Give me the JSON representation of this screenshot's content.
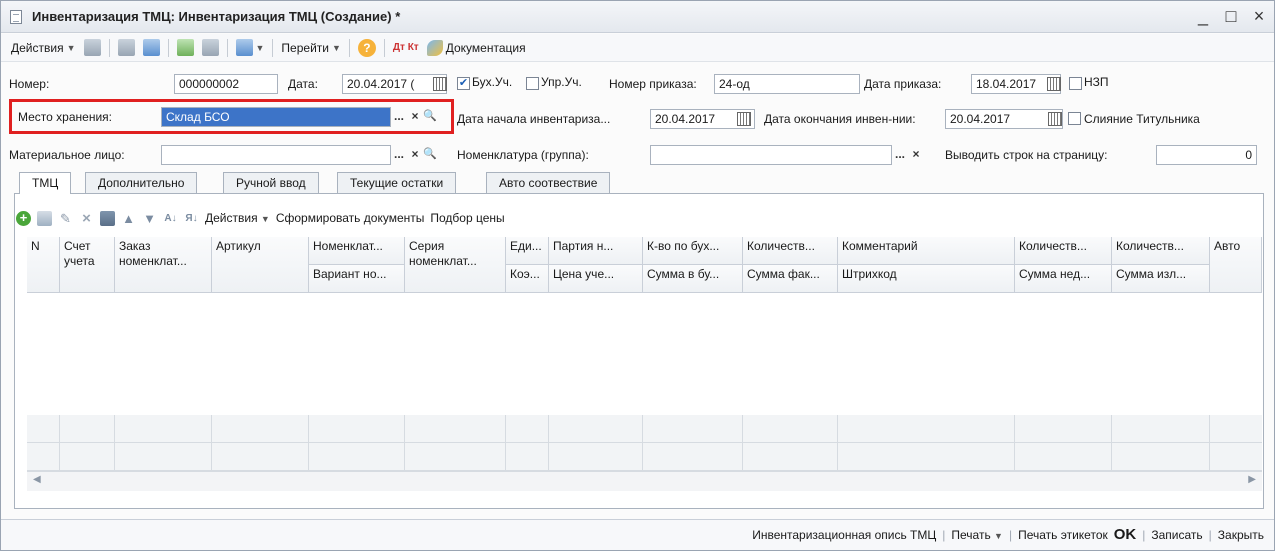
{
  "window": {
    "title": "Инвентаризация ТМЦ: Инвентаризация ТМЦ (Создание) *",
    "controls": [
      "_",
      "□",
      "×"
    ]
  },
  "toolbar": {
    "actions_label": "Действия",
    "goto_label": "Перейти",
    "help_label": "?",
    "dtkt_label": "Дт Кт",
    "documentation_label": "Документация"
  },
  "form": {
    "number_label": "Номер:",
    "number_value": "000000002",
    "date_label": "Дата:",
    "date_value": "20.04.2017 (",
    "buh_label": "Бух.Уч.",
    "buh_checked": "✔",
    "upr_label": "Упр.Уч.",
    "order_num_label": "Номер приказа:",
    "order_num_value": "24-од",
    "order_date_label": "Дата приказа:",
    "order_date_value": "18.04.2017",
    "nzp_label": "НЗП",
    "storage_label": "Место хранения:",
    "storage_value": "Склад БСО",
    "start_date_label": "Дата начала инвентариза...",
    "start_date_value": "20.04.2017",
    "end_date_label": "Дата окончания инвен-нии:",
    "end_date_value": "20.04.2017",
    "merge_label": "Слияние Титульника",
    "responsible_label": "Материальное лицо:",
    "responsible_value": "",
    "nomenclature_label": "Номенклатура (группа):",
    "nomenclature_value": "",
    "rows_per_page_label": "Выводить строк на страницу:",
    "rows_per_page_value": "0",
    "ellipsis": "...",
    "clear": "×",
    "search": "🔍"
  },
  "tabs": [
    {
      "label": "ТМЦ"
    },
    {
      "label": "Дополнительно"
    },
    {
      "label": "Ручной ввод"
    },
    {
      "label": "Текущие остатки"
    },
    {
      "label": "Авто соотвествие"
    }
  ],
  "table_toolbar": {
    "actions_label": "Действия",
    "generate_docs_label": "Сформировать документы",
    "price_pick_label": "Подбор цены"
  },
  "grid": {
    "columns_top": [
      "N",
      "Счет учета",
      "Заказ номенклат...",
      "Артикул",
      "Номенклат...",
      "Серия номенклат...",
      "Еди...",
      "Партия н...",
      "К-во по бух...",
      "Количеств...",
      "Комментарий",
      "Количеств...",
      "Количеств...",
      "Авто"
    ],
    "columns_bottom": [
      "Вариант но...",
      "Коэ...",
      "Цена уче...",
      "Сумма в бу...",
      "Сумма фак...",
      "Штрихкод",
      "Сумма нед...",
      "Сумма изл..."
    ]
  },
  "bottombar": {
    "inventory_list_label": "Инвентаризационная опись ТМЦ",
    "print_label": "Печать",
    "print_labels_label": "Печать этикеток",
    "ok_label": "OK",
    "save_label": "Записать",
    "close_label": "Закрыть"
  }
}
